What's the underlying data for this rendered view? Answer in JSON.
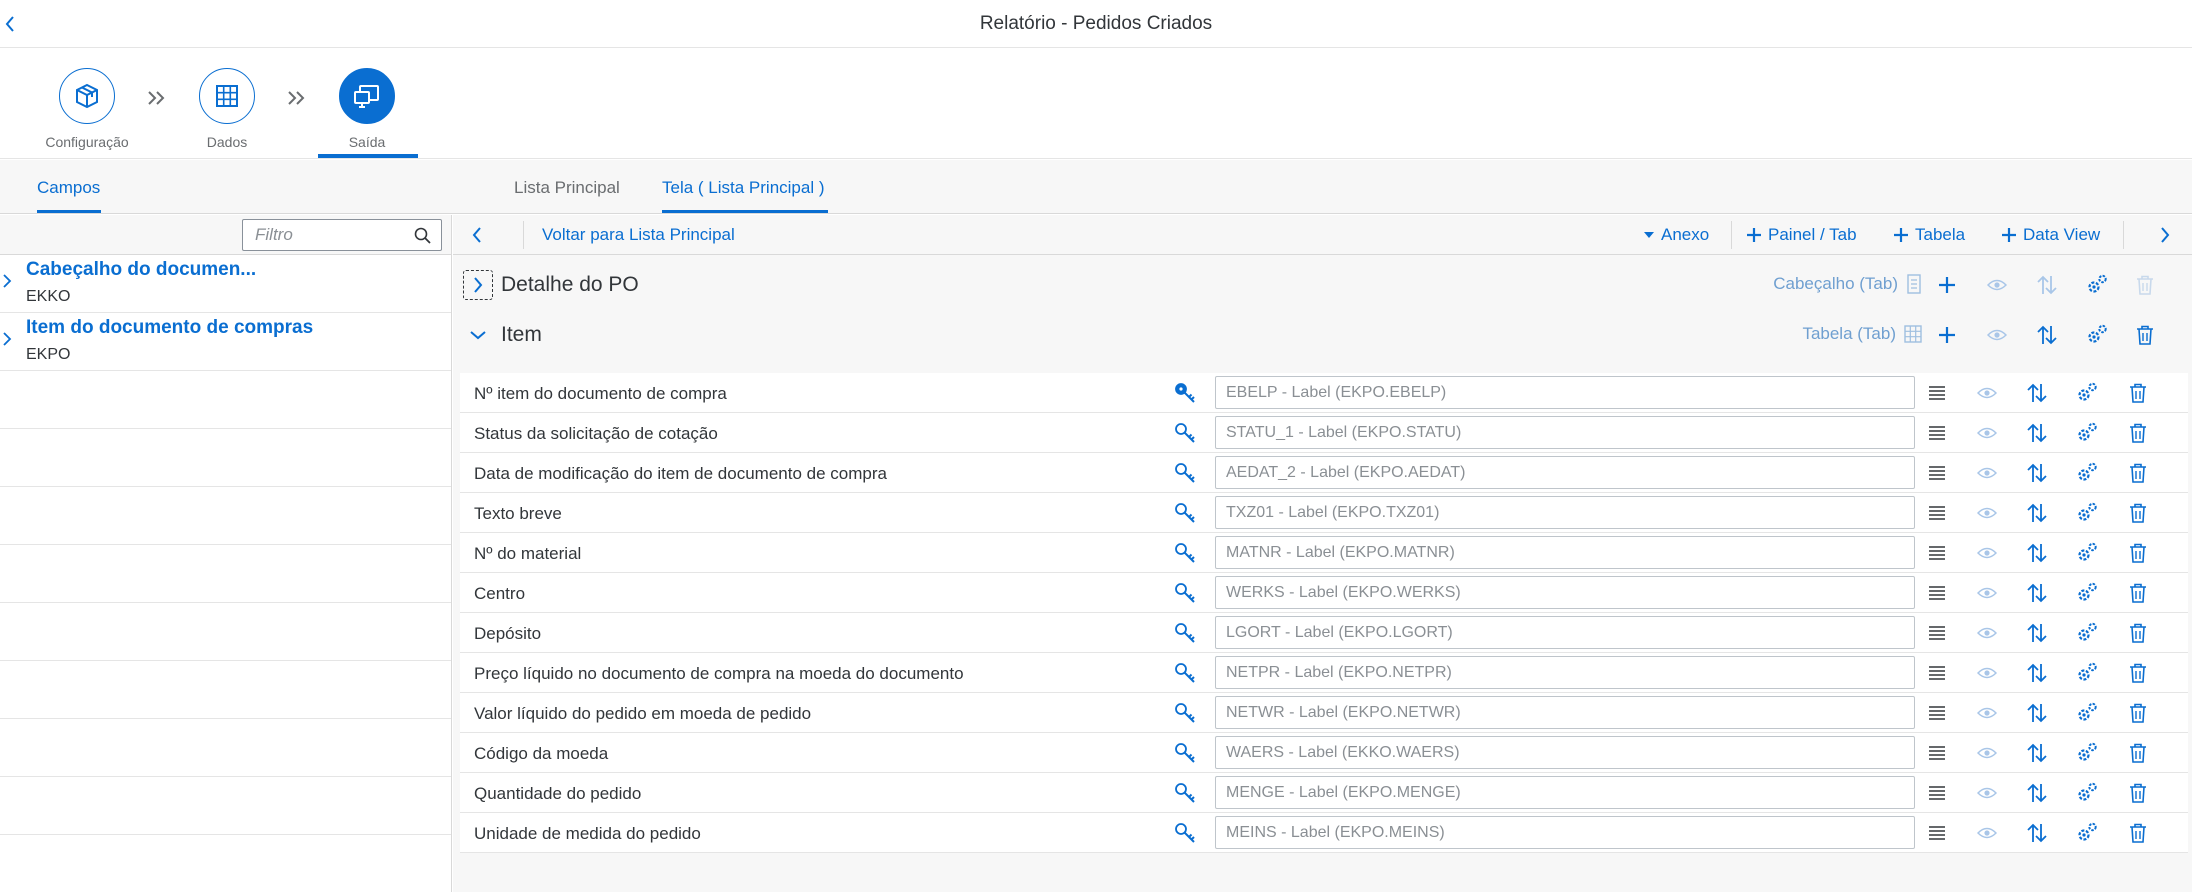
{
  "window": {
    "title": "Relatório - Pedidos Criados"
  },
  "wizard": {
    "steps": [
      {
        "label": "Configuração",
        "icon": "package-icon"
      },
      {
        "label": "Dados",
        "icon": "grid-icon"
      },
      {
        "label": "Saída",
        "icon": "output-screens-icon"
      }
    ]
  },
  "tabs": {
    "left": {
      "label": "Campos"
    },
    "right": [
      {
        "label": "Lista Principal"
      },
      {
        "label": "Tela ( Lista Principal )"
      }
    ]
  },
  "filter": {
    "placeholder": "Filtro",
    "value": ""
  },
  "sources": [
    {
      "title": "Cabeçalho do documen...",
      "code": "EKKO"
    },
    {
      "title": "Item do documento de compras",
      "code": "EKPO"
    }
  ],
  "toolbar": {
    "back_link": "Voltar para Lista Principal",
    "attach": "Anexo",
    "add_panel": "Painel / Tab",
    "add_table": "Tabela",
    "add_dataview": "Data View"
  },
  "sections": [
    {
      "name": "Detalhe do PO",
      "type": "Cabeçalho (Tab)",
      "expanded": false
    },
    {
      "name": "Item",
      "type": "Tabela (Tab)",
      "expanded": true
    }
  ],
  "fields": [
    {
      "label": "Nº item do documento de compra",
      "placeholder": "EBELP - Label (EKPO.EBELP)",
      "key": true
    },
    {
      "label": "Status da solicitação de cotação",
      "placeholder": "STATU_1 - Label (EKPO.STATU)",
      "key": false
    },
    {
      "label": "Data de modificação do item de documento de compra",
      "placeholder": "AEDAT_2 - Label (EKPO.AEDAT)",
      "key": false
    },
    {
      "label": "Texto breve",
      "placeholder": "TXZ01 - Label (EKPO.TXZ01)",
      "key": false
    },
    {
      "label": "Nº do material",
      "placeholder": "MATNR - Label (EKPO.MATNR)",
      "key": false
    },
    {
      "label": "Centro",
      "placeholder": "WERKS - Label (EKPO.WERKS)",
      "key": false
    },
    {
      "label": "Depósito",
      "placeholder": "LGORT - Label (EKPO.LGORT)",
      "key": false
    },
    {
      "label": "Preço líquido no documento de compra na moeda do documento",
      "placeholder": "NETPR - Label (EKPO.NETPR)",
      "key": false
    },
    {
      "label": "Valor líquido do pedido em moeda de pedido",
      "placeholder": "NETWR - Label (EKPO.NETWR)",
      "key": false
    },
    {
      "label": "Código da moeda",
      "placeholder": "WAERS - Label (EKKO.WAERS)",
      "key": false
    },
    {
      "label": "Quantidade do pedido",
      "placeholder": "MENGE - Label (EKPO.MENGE)",
      "key": false
    },
    {
      "label": "Unidade de medida do pedido",
      "placeholder": "MEINS - Label (EKPO.MEINS)",
      "key": false
    }
  ],
  "colors": {
    "accent": "#0a6ed1",
    "muted_accent": "#6f9fd0",
    "text": "#32363a",
    "light_icon": "#a9c6e8"
  }
}
